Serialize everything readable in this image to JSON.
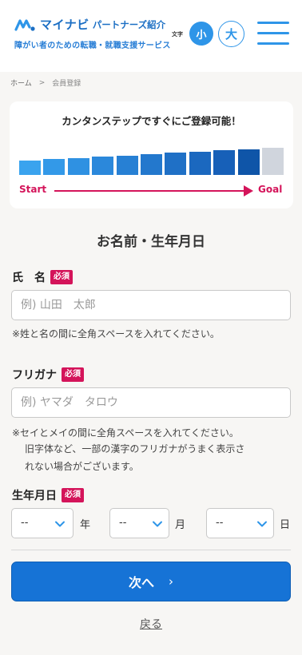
{
  "header": {
    "logo_main": "マイナビ",
    "logo_sub": "パートナーズ紹介",
    "tagline": "障がい者のための転職・就職支援サービス",
    "font_size_label": "文字",
    "font_small": "小",
    "font_large": "大"
  },
  "breadcrumb": {
    "home": "ホーム",
    "separator": ">",
    "current": "会員登録"
  },
  "progress": {
    "title": "カンタンステップですぐにご登録可能！",
    "start": "Start",
    "goal": "Goal",
    "total_steps": 11,
    "completed_steps": 10,
    "colors": [
      "#3aa3ee",
      "#3399e8",
      "#2f91e2",
      "#2b88db",
      "#2780d4",
      "#2378cd",
      "#1f70c6",
      "#1b68bf",
      "#1760b8",
      "#0f55a8",
      "#d0d5dd"
    ]
  },
  "form": {
    "title": "お名前・生年月日",
    "required_label": "必須",
    "name": {
      "label": "氏　名",
      "placeholder": "例) 山田　太郎",
      "value": "",
      "note": "※姓と名の間に全角スペースを入れてください。"
    },
    "furigana": {
      "label": "フリガナ",
      "placeholder": "例) ヤマダ　タロウ",
      "value": "",
      "note_line1": "※セイとメイの間に全角スペースを入れてください。",
      "note_line2": "旧字体など、一部の漢字のフリガナがうまく表示さ",
      "note_line3": "れない場合がございます。"
    },
    "birthdate": {
      "label": "生年月日",
      "year_value": "--",
      "month_value": "--",
      "day_value": "--",
      "year_unit": "年",
      "month_unit": "月",
      "day_unit": "日"
    }
  },
  "actions": {
    "next": "次へ",
    "back": "戻る"
  },
  "colors": {
    "brand": "#1c6fc4",
    "accent": "#2e95e8",
    "required": "#d4145a",
    "primary_button": "#1673d6"
  }
}
